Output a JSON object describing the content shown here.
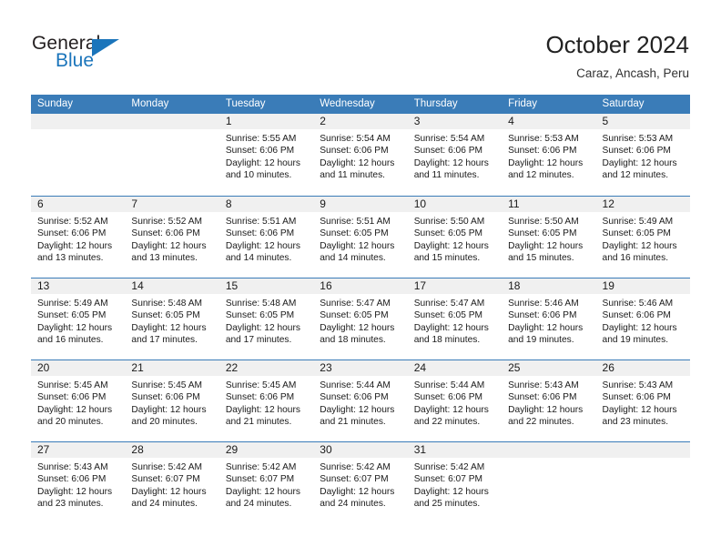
{
  "brand": {
    "name_part1": "General",
    "name_part2": "Blue",
    "accent_color": "#1b75bb"
  },
  "header": {
    "title": "October 2024",
    "location": "Caraz, Ancash, Peru"
  },
  "theme": {
    "header_blue": "#3a7cb8",
    "daystrip_gray": "#f0f0f0",
    "text_color": "#1a1a1a"
  },
  "calendar": {
    "weekdays": [
      "Sunday",
      "Monday",
      "Tuesday",
      "Wednesday",
      "Thursday",
      "Friday",
      "Saturday"
    ],
    "weeks": [
      [
        {
          "day": "",
          "lines": []
        },
        {
          "day": "",
          "lines": []
        },
        {
          "day": "1",
          "lines": [
            "Sunrise: 5:55 AM",
            "Sunset: 6:06 PM",
            "Daylight: 12 hours",
            "and 10 minutes."
          ]
        },
        {
          "day": "2",
          "lines": [
            "Sunrise: 5:54 AM",
            "Sunset: 6:06 PM",
            "Daylight: 12 hours",
            "and 11 minutes."
          ]
        },
        {
          "day": "3",
          "lines": [
            "Sunrise: 5:54 AM",
            "Sunset: 6:06 PM",
            "Daylight: 12 hours",
            "and 11 minutes."
          ]
        },
        {
          "day": "4",
          "lines": [
            "Sunrise: 5:53 AM",
            "Sunset: 6:06 PM",
            "Daylight: 12 hours",
            "and 12 minutes."
          ]
        },
        {
          "day": "5",
          "lines": [
            "Sunrise: 5:53 AM",
            "Sunset: 6:06 PM",
            "Daylight: 12 hours",
            "and 12 minutes."
          ]
        }
      ],
      [
        {
          "day": "6",
          "lines": [
            "Sunrise: 5:52 AM",
            "Sunset: 6:06 PM",
            "Daylight: 12 hours",
            "and 13 minutes."
          ]
        },
        {
          "day": "7",
          "lines": [
            "Sunrise: 5:52 AM",
            "Sunset: 6:06 PM",
            "Daylight: 12 hours",
            "and 13 minutes."
          ]
        },
        {
          "day": "8",
          "lines": [
            "Sunrise: 5:51 AM",
            "Sunset: 6:06 PM",
            "Daylight: 12 hours",
            "and 14 minutes."
          ]
        },
        {
          "day": "9",
          "lines": [
            "Sunrise: 5:51 AM",
            "Sunset: 6:05 PM",
            "Daylight: 12 hours",
            "and 14 minutes."
          ]
        },
        {
          "day": "10",
          "lines": [
            "Sunrise: 5:50 AM",
            "Sunset: 6:05 PM",
            "Daylight: 12 hours",
            "and 15 minutes."
          ]
        },
        {
          "day": "11",
          "lines": [
            "Sunrise: 5:50 AM",
            "Sunset: 6:05 PM",
            "Daylight: 12 hours",
            "and 15 minutes."
          ]
        },
        {
          "day": "12",
          "lines": [
            "Sunrise: 5:49 AM",
            "Sunset: 6:05 PM",
            "Daylight: 12 hours",
            "and 16 minutes."
          ]
        }
      ],
      [
        {
          "day": "13",
          "lines": [
            "Sunrise: 5:49 AM",
            "Sunset: 6:05 PM",
            "Daylight: 12 hours",
            "and 16 minutes."
          ]
        },
        {
          "day": "14",
          "lines": [
            "Sunrise: 5:48 AM",
            "Sunset: 6:05 PM",
            "Daylight: 12 hours",
            "and 17 minutes."
          ]
        },
        {
          "day": "15",
          "lines": [
            "Sunrise: 5:48 AM",
            "Sunset: 6:05 PM",
            "Daylight: 12 hours",
            "and 17 minutes."
          ]
        },
        {
          "day": "16",
          "lines": [
            "Sunrise: 5:47 AM",
            "Sunset: 6:05 PM",
            "Daylight: 12 hours",
            "and 18 minutes."
          ]
        },
        {
          "day": "17",
          "lines": [
            "Sunrise: 5:47 AM",
            "Sunset: 6:05 PM",
            "Daylight: 12 hours",
            "and 18 minutes."
          ]
        },
        {
          "day": "18",
          "lines": [
            "Sunrise: 5:46 AM",
            "Sunset: 6:06 PM",
            "Daylight: 12 hours",
            "and 19 minutes."
          ]
        },
        {
          "day": "19",
          "lines": [
            "Sunrise: 5:46 AM",
            "Sunset: 6:06 PM",
            "Daylight: 12 hours",
            "and 19 minutes."
          ]
        }
      ],
      [
        {
          "day": "20",
          "lines": [
            "Sunrise: 5:45 AM",
            "Sunset: 6:06 PM",
            "Daylight: 12 hours",
            "and 20 minutes."
          ]
        },
        {
          "day": "21",
          "lines": [
            "Sunrise: 5:45 AM",
            "Sunset: 6:06 PM",
            "Daylight: 12 hours",
            "and 20 minutes."
          ]
        },
        {
          "day": "22",
          "lines": [
            "Sunrise: 5:45 AM",
            "Sunset: 6:06 PM",
            "Daylight: 12 hours",
            "and 21 minutes."
          ]
        },
        {
          "day": "23",
          "lines": [
            "Sunrise: 5:44 AM",
            "Sunset: 6:06 PM",
            "Daylight: 12 hours",
            "and 21 minutes."
          ]
        },
        {
          "day": "24",
          "lines": [
            "Sunrise: 5:44 AM",
            "Sunset: 6:06 PM",
            "Daylight: 12 hours",
            "and 22 minutes."
          ]
        },
        {
          "day": "25",
          "lines": [
            "Sunrise: 5:43 AM",
            "Sunset: 6:06 PM",
            "Daylight: 12 hours",
            "and 22 minutes."
          ]
        },
        {
          "day": "26",
          "lines": [
            "Sunrise: 5:43 AM",
            "Sunset: 6:06 PM",
            "Daylight: 12 hours",
            "and 23 minutes."
          ]
        }
      ],
      [
        {
          "day": "27",
          "lines": [
            "Sunrise: 5:43 AM",
            "Sunset: 6:06 PM",
            "Daylight: 12 hours",
            "and 23 minutes."
          ]
        },
        {
          "day": "28",
          "lines": [
            "Sunrise: 5:42 AM",
            "Sunset: 6:07 PM",
            "Daylight: 12 hours",
            "and 24 minutes."
          ]
        },
        {
          "day": "29",
          "lines": [
            "Sunrise: 5:42 AM",
            "Sunset: 6:07 PM",
            "Daylight: 12 hours",
            "and 24 minutes."
          ]
        },
        {
          "day": "30",
          "lines": [
            "Sunrise: 5:42 AM",
            "Sunset: 6:07 PM",
            "Daylight: 12 hours",
            "and 24 minutes."
          ]
        },
        {
          "day": "31",
          "lines": [
            "Sunrise: 5:42 AM",
            "Sunset: 6:07 PM",
            "Daylight: 12 hours",
            "and 25 minutes."
          ]
        },
        {
          "day": "",
          "lines": []
        },
        {
          "day": "",
          "lines": []
        }
      ]
    ]
  }
}
